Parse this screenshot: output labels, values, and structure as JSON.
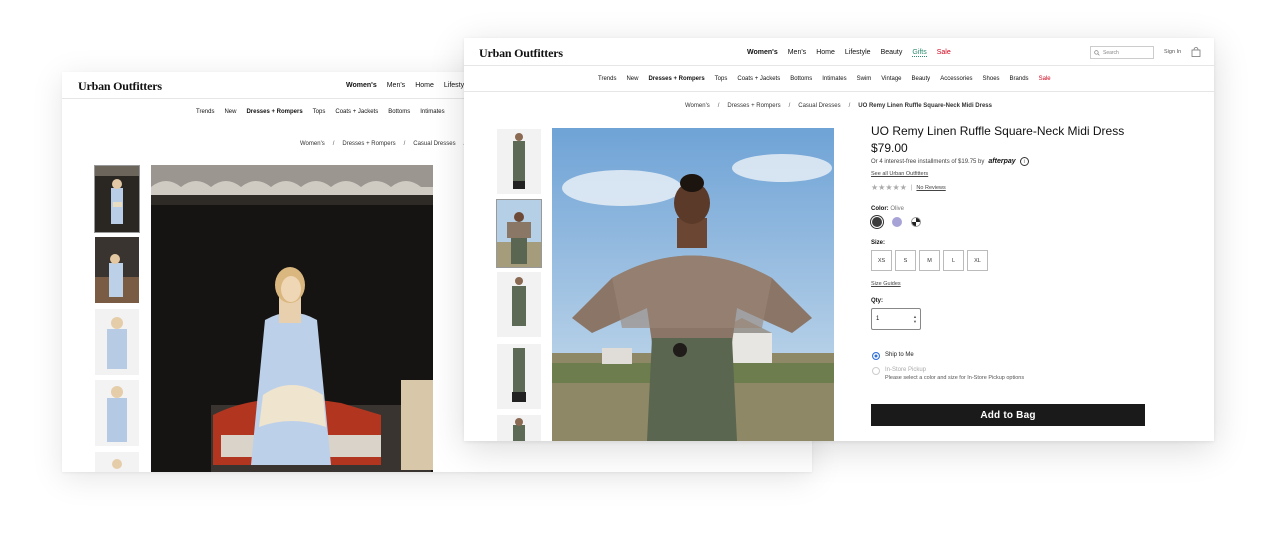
{
  "brand": {
    "logo": "Urban Outfitters"
  },
  "back": {
    "nav": [
      "Women's",
      "Men's",
      "Home",
      "Lifestyle"
    ],
    "subnav": [
      "Trends",
      "New",
      "Dresses + Rompers",
      "Tops",
      "Coats + Jackets",
      "Bottoms",
      "Intimates"
    ],
    "breadcrumb": [
      "Women's",
      "Dresses + Rompers",
      "Casual Dresses"
    ]
  },
  "front": {
    "nav": [
      "Women's",
      "Men's",
      "Home",
      "Lifestyle",
      "Beauty",
      "Gifts",
      "Sale"
    ],
    "search_placeholder": "Search",
    "sign_in": "Sign In",
    "subnav": [
      "Trends",
      "New",
      "Dresses + Rompers",
      "Tops",
      "Coats + Jackets",
      "Bottoms",
      "Intimates",
      "Swim",
      "Vintage",
      "Beauty",
      "Accessories",
      "Shoes",
      "Brands",
      "Sale"
    ],
    "breadcrumb": [
      "Women's",
      "Dresses + Rompers",
      "Casual Dresses",
      "UO Remy Linen Ruffle Square-Neck Midi Dress"
    ],
    "product": {
      "title": "UO Remy Linen Ruffle Square-Neck Midi Dress",
      "price": "$79.00",
      "installments": "Or 4 interest-free installments of $19.75 by",
      "afterpay": "afterpay",
      "see_all": "See all Urban Outfitters",
      "stars": "★★★★★",
      "reviews_sep": "|",
      "reviews": "No Reviews",
      "color_label": "Color:",
      "color_value": "Olive",
      "swatch_colors": [
        "#3c3c3c",
        "#a7a3d6",
        "#222222"
      ],
      "size_label": "Size:",
      "sizes": [
        "XS",
        "S",
        "M",
        "L",
        "XL"
      ],
      "size_guides": "Size Guides",
      "qty_label": "Qty:",
      "qty_value": "1",
      "ship_label": "Ship to Me",
      "pickup_label": "In-Store Pickup",
      "pickup_note": "Please select a color and size for In-Store Pickup options",
      "add_to_bag": "Add to Bag"
    }
  },
  "colors": {
    "sale": "#d0021b",
    "radio_selected": "#2f6fdf",
    "button": "#1a1a1a"
  }
}
